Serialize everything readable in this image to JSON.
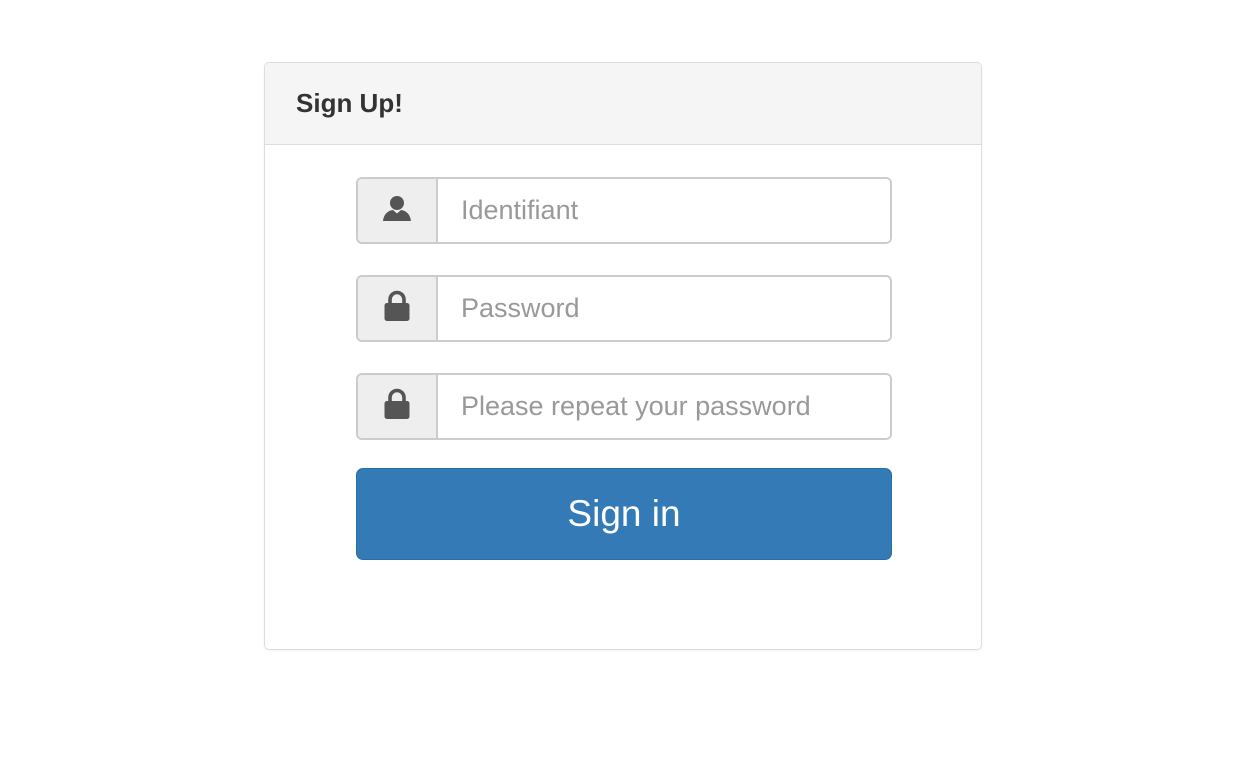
{
  "panel": {
    "title": "Sign Up!"
  },
  "form": {
    "fields": [
      {
        "icon": "user-icon",
        "placeholder": "Identifiant",
        "value": ""
      },
      {
        "icon": "lock-icon",
        "placeholder": "Password",
        "value": ""
      },
      {
        "icon": "lock-icon",
        "placeholder": "Please repeat your password",
        "value": ""
      }
    ],
    "submit_label": "Sign in"
  },
  "colors": {
    "primary": "#337ab7",
    "heading_bg": "#f5f5f5",
    "addon_bg": "#eeeeee",
    "icon": "#555555",
    "title_text": "#333333"
  }
}
